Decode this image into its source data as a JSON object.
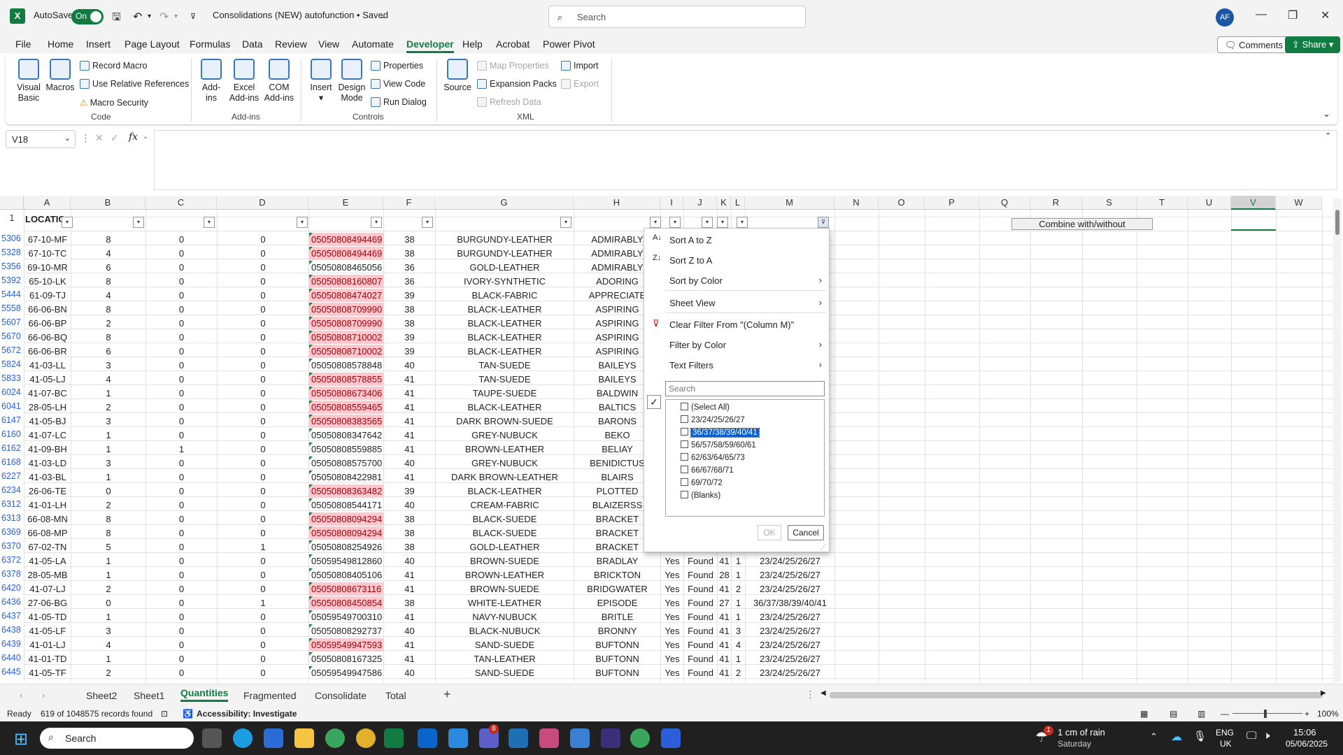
{
  "titlebar": {
    "autosave": "AutoSave",
    "toggle": "On",
    "doc_title": "Consolidations (NEW) autofunction • Saved",
    "search_placeholder": "Search",
    "avatar": "AF"
  },
  "menu": [
    "File",
    "Home",
    "Insert",
    "Page Layout",
    "Formulas",
    "Data",
    "Review",
    "View",
    "Automate",
    "Developer",
    "Help",
    "Acrobat",
    "Power Pivot"
  ],
  "menu_active": "Developer",
  "top_buttons": {
    "comments": "Comments",
    "share": "Share"
  },
  "ribbon": {
    "code": {
      "visual_basic": "Visual Basic",
      "macros": "Macros",
      "record_macro": "Record Macro",
      "use_relative": "Use Relative References",
      "macro_security": "Macro Security",
      "group": "Code"
    },
    "addins": {
      "addins": "Add-ins",
      "excel_addins": "Excel Add-ins",
      "com_addins": "COM Add-ins",
      "group": "Add-ins"
    },
    "controls": {
      "insert": "Insert",
      "design_mode": "Design Mode",
      "properties": "Properties",
      "view_code": "View Code",
      "run_dialog": "Run Dialog",
      "group": "Controls"
    },
    "xml": {
      "source": "Source",
      "map_properties": "Map Properties",
      "expansion_packs": "Expansion Packs",
      "refresh_data": "Refresh Data",
      "import": "Import",
      "export": "Export",
      "group": "XML"
    }
  },
  "namebox": "V18",
  "columns": [
    "A",
    "B",
    "C",
    "D",
    "E",
    "F",
    "G",
    "H",
    "I",
    "J",
    "K",
    "L",
    "M",
    "N",
    "O",
    "P",
    "Q",
    "R",
    "S",
    "T",
    "U",
    "V",
    "W"
  ],
  "header_row": {
    "rownum": "1",
    "a1": "LOCATIC",
    "button": "Combine with/without"
  },
  "rows": [
    {
      "r": "5306",
      "a": "67-10-MF",
      "b": "8",
      "c": "0",
      "d": "0",
      "e": "05050808494469",
      "p": true,
      "f": "38",
      "g": "BURGUNDY-LEATHER",
      "h": "ADMIRABLY"
    },
    {
      "r": "5328",
      "a": "67-10-TC",
      "b": "4",
      "c": "0",
      "d": "0",
      "e": "05050808494469",
      "p": true,
      "f": "38",
      "g": "BURGUNDY-LEATHER",
      "h": "ADMIRABLY"
    },
    {
      "r": "5356",
      "a": "69-10-MR",
      "b": "6",
      "c": "0",
      "d": "0",
      "e": "05050808465056",
      "p": false,
      "f": "36",
      "g": "GOLD-LEATHER",
      "h": "ADMIRABLY"
    },
    {
      "r": "5392",
      "a": "65-10-LK",
      "b": "8",
      "c": "0",
      "d": "0",
      "e": "05050808160807",
      "p": true,
      "f": "36",
      "g": "IVORY-SYNTHETIC",
      "h": "ADORING"
    },
    {
      "r": "5444",
      "a": "61-09-TJ",
      "b": "4",
      "c": "0",
      "d": "0",
      "e": "05050808474027",
      "p": true,
      "f": "39",
      "g": "BLACK-FABRIC",
      "h": "APPRECIATE"
    },
    {
      "r": "5558",
      "a": "66-06-BN",
      "b": "8",
      "c": "0",
      "d": "0",
      "e": "05050808709990",
      "p": true,
      "f": "38",
      "g": "BLACK-LEATHER",
      "h": "ASPIRING"
    },
    {
      "r": "5607",
      "a": "66-06-BP",
      "b": "2",
      "c": "0",
      "d": "0",
      "e": "05050808709990",
      "p": true,
      "f": "38",
      "g": "BLACK-LEATHER",
      "h": "ASPIRING"
    },
    {
      "r": "5670",
      "a": "66-06-BQ",
      "b": "8",
      "c": "0",
      "d": "0",
      "e": "05050808710002",
      "p": true,
      "f": "39",
      "g": "BLACK-LEATHER",
      "h": "ASPIRING"
    },
    {
      "r": "5672",
      "a": "66-06-BR",
      "b": "6",
      "c": "0",
      "d": "0",
      "e": "05050808710002",
      "p": true,
      "f": "39",
      "g": "BLACK-LEATHER",
      "h": "ASPIRING"
    },
    {
      "r": "5824",
      "a": "41-03-LL",
      "b": "3",
      "c": "0",
      "d": "0",
      "e": "05050808578848",
      "p": false,
      "f": "40",
      "g": "TAN-SUEDE",
      "h": "BAILEYS"
    },
    {
      "r": "5833",
      "a": "41-05-LJ",
      "b": "4",
      "c": "0",
      "d": "0",
      "e": "05050808578855",
      "p": true,
      "f": "41",
      "g": "TAN-SUEDE",
      "h": "BAILEYS"
    },
    {
      "r": "6024",
      "a": "41-07-BC",
      "b": "1",
      "c": "0",
      "d": "0",
      "e": "05050808673406",
      "p": true,
      "f": "41",
      "g": "TAUPE-SUEDE",
      "h": "BALDWIN"
    },
    {
      "r": "6041",
      "a": "28-05-LH",
      "b": "2",
      "c": "0",
      "d": "0",
      "e": "05050808559465",
      "p": true,
      "f": "41",
      "g": "BLACK-LEATHER",
      "h": "BALTICS"
    },
    {
      "r": "6147",
      "a": "41-05-BJ",
      "b": "3",
      "c": "0",
      "d": "0",
      "e": "05050808383565",
      "p": true,
      "f": "41",
      "g": "DARK BROWN-SUEDE",
      "h": "BARONS"
    },
    {
      "r": "6160",
      "a": "41-07-LC",
      "b": "1",
      "c": "0",
      "d": "0",
      "e": "05050808347642",
      "p": false,
      "f": "41",
      "g": "GREY-NUBUCK",
      "h": "BEKO"
    },
    {
      "r": "6162",
      "a": "41-09-BH",
      "b": "1",
      "c": "1",
      "d": "0",
      "e": "05050808559885",
      "p": false,
      "f": "41",
      "g": "BROWN-LEATHER",
      "h": "BELIAY"
    },
    {
      "r": "6168",
      "a": "41-03-LD",
      "b": "3",
      "c": "0",
      "d": "0",
      "e": "05050808575700",
      "p": false,
      "f": "40",
      "g": "GREY-NUBUCK",
      "h": "BENIDICTUS"
    },
    {
      "r": "6227",
      "a": "41-03-BL",
      "b": "1",
      "c": "0",
      "d": "0",
      "e": "05050808422981",
      "p": false,
      "f": "41",
      "g": "DARK BROWN-LEATHER",
      "h": "BLAIRS"
    },
    {
      "r": "6234",
      "a": "26-06-TE",
      "b": "0",
      "c": "0",
      "d": "0",
      "e": "05050808363482",
      "p": true,
      "f": "39",
      "g": "BLACK-LEATHER",
      "h": "PLOTTED"
    },
    {
      "r": "6312",
      "a": "41-01-LH",
      "b": "2",
      "c": "0",
      "d": "0",
      "e": "05050808544171",
      "p": false,
      "f": "40",
      "g": "CREAM-FABRIC",
      "h": "BLAIZERSS"
    },
    {
      "r": "6313",
      "a": "66-08-MN",
      "b": "8",
      "c": "0",
      "d": "0",
      "e": "05050808094294",
      "p": true,
      "f": "38",
      "g": "BLACK-SUEDE",
      "h": "BRACKET"
    },
    {
      "r": "6369",
      "a": "66-08-MP",
      "b": "8",
      "c": "0",
      "d": "0",
      "e": "05050808094294",
      "p": true,
      "f": "38",
      "g": "BLACK-SUEDE",
      "h": "BRACKET"
    },
    {
      "r": "6370",
      "a": "67-02-TN",
      "b": "5",
      "c": "0",
      "d": "1",
      "e": "05050808254926",
      "p": false,
      "f": "38",
      "g": "GOLD-LEATHER",
      "h": "BRACKET"
    },
    {
      "r": "6372",
      "a": "41-05-LA",
      "b": "1",
      "c": "0",
      "d": "0",
      "e": "05059549812860",
      "p": false,
      "f": "40",
      "g": "BROWN-SUEDE",
      "h": "BRADLAY",
      "i": "Yes",
      "j": "Found",
      "k": "41",
      "l": "1",
      "m": "23/24/25/26/27"
    },
    {
      "r": "6378",
      "a": "28-05-MB",
      "b": "1",
      "c": "0",
      "d": "0",
      "e": "05050808405106",
      "p": false,
      "f": "41",
      "g": "BROWN-LEATHER",
      "h": "BRICKTON",
      "i": "Yes",
      "j": "Found",
      "k": "28",
      "l": "1",
      "m": "23/24/25/26/27"
    },
    {
      "r": "6420",
      "a": "41-07-LJ",
      "b": "2",
      "c": "0",
      "d": "0",
      "e": "05050808673116",
      "p": true,
      "f": "41",
      "g": "BROWN-SUEDE",
      "h": "BRIDGWATER",
      "i": "Yes",
      "j": "Found",
      "k": "41",
      "l": "2",
      "m": "23/24/25/26/27"
    },
    {
      "r": "6436",
      "a": "27-06-BG",
      "b": "0",
      "c": "0",
      "d": "1",
      "e": "05050808450854",
      "p": true,
      "f": "38",
      "g": "WHITE-LEATHER",
      "h": "EPISODE",
      "i": "Yes",
      "j": "Found",
      "k": "27",
      "l": "1",
      "m": "36/37/38/39/40/41"
    },
    {
      "r": "6437",
      "a": "41-05-TD",
      "b": "1",
      "c": "0",
      "d": "0",
      "e": "05059549700310",
      "p": false,
      "f": "41",
      "g": "NAVY-NUBUCK",
      "h": "BRITLE",
      "i": "Yes",
      "j": "Found",
      "k": "41",
      "l": "1",
      "m": "23/24/25/26/27"
    },
    {
      "r": "6438",
      "a": "41-05-LF",
      "b": "3",
      "c": "0",
      "d": "0",
      "e": "05050808292737",
      "p": false,
      "f": "40",
      "g": "BLACK-NUBUCK",
      "h": "BRONNY",
      "i": "Yes",
      "j": "Found",
      "k": "41",
      "l": "3",
      "m": "23/24/25/26/27"
    },
    {
      "r": "6439",
      "a": "41-01-LJ",
      "b": "4",
      "c": "0",
      "d": "0",
      "e": "05059549947593",
      "p": true,
      "f": "41",
      "g": "SAND-SUEDE",
      "h": "BUFTONN",
      "i": "Yes",
      "j": "Found",
      "k": "41",
      "l": "4",
      "m": "23/24/25/26/27"
    },
    {
      "r": "6440",
      "a": "41-01-TD",
      "b": "1",
      "c": "0",
      "d": "0",
      "e": "05050808167325",
      "p": false,
      "f": "41",
      "g": "TAN-LEATHER",
      "h": "BUFTONN",
      "i": "Yes",
      "j": "Found",
      "k": "41",
      "l": "1",
      "m": "23/24/25/26/27"
    },
    {
      "r": "6445",
      "a": "41-05-TF",
      "b": "2",
      "c": "0",
      "d": "0",
      "e": "05059549947586",
      "p": false,
      "f": "40",
      "g": "SAND-SUEDE",
      "h": "BUFTONN",
      "i": "Yes",
      "j": "Found",
      "k": "41",
      "l": "2",
      "m": "23/24/25/26/27"
    }
  ],
  "dropdown": {
    "sort_az": "Sort A to Z",
    "sort_za": "Sort Z to A",
    "sort_color": "Sort by Color",
    "sheet_view": "Sheet View",
    "clear_filter": "Clear Filter From \"(Column M)\"",
    "filter_color": "Filter by Color",
    "text_filters": "Text Filters",
    "search_placeholder": "Search",
    "values": [
      "(Select All)",
      "23/24/25/26/27",
      "36/37/38/39/40/41",
      "56/57/58/59/60/61",
      "62/63/64/65/73",
      "66/67/68/71",
      "69/70/72",
      "(Blanks)"
    ],
    "ok": "OK",
    "cancel": "Cancel"
  },
  "sheets": [
    "Sheet2",
    "Sheet1",
    "Quantities",
    "Fragmented",
    "Consolidate",
    "Total"
  ],
  "sheet_active": "Quantities",
  "status": {
    "ready": "Ready",
    "records": "619 of 1048575 records found",
    "accessibility": "Accessibility: Investigate",
    "zoom": "100%"
  },
  "taskbar": {
    "search": "Search",
    "weather": "1 cm of rain",
    "weather_day": "Saturday",
    "lang": "ENG",
    "region": "UK",
    "time": "15:06",
    "date": "05/06/2025",
    "weather_badge": "1",
    "teams_badge": "8"
  },
  "colors": {
    "excel_green": "#107c41",
    "pink_fill": "#ffc7ce",
    "selection": "#0b5fce"
  }
}
